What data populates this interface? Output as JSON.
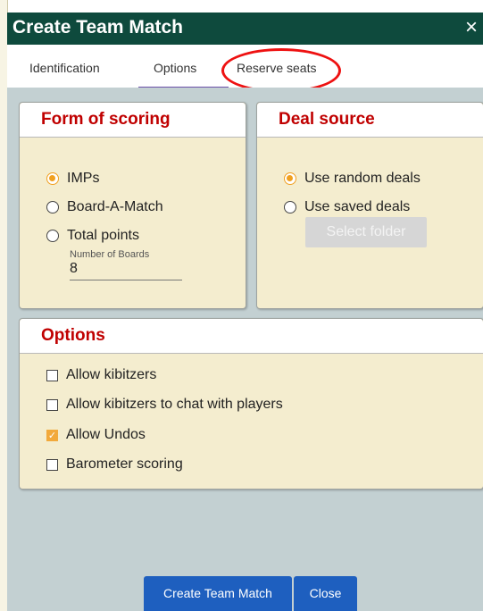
{
  "dialog": {
    "title": "Create Team Match",
    "close_glyph": "×"
  },
  "tabs": [
    {
      "label": "Identification"
    },
    {
      "label": "Options",
      "active": true
    },
    {
      "label": "Reserve seats",
      "highlighted": true
    }
  ],
  "scoring": {
    "heading": "Form of scoring",
    "options": [
      {
        "label": "IMPs",
        "selected": true
      },
      {
        "label": "Board-A-Match",
        "selected": false
      },
      {
        "label": "Total points",
        "selected": false
      }
    ],
    "boards_label": "Number of Boards",
    "boards_value": "8"
  },
  "deal_source": {
    "heading": "Deal source",
    "options": [
      {
        "label": "Use random deals",
        "selected": true
      },
      {
        "label": "Use saved deals",
        "selected": false
      }
    ],
    "select_folder_label": "Select folder"
  },
  "options": {
    "heading": "Options",
    "checks": [
      {
        "label": "Allow kibitzers",
        "checked": false
      },
      {
        "label": "Allow kibitzers to chat with players",
        "checked": false
      },
      {
        "label": "Allow Undos",
        "checked": true
      },
      {
        "label": "Barometer scoring",
        "checked": false
      }
    ]
  },
  "footer": {
    "create_label": "Create Team Match",
    "close_label": "Close"
  },
  "colors": {
    "titlebar": "#0e4a3d",
    "accent": "#c00000",
    "selected": "#f0a020",
    "primary_button": "#1e5fbf",
    "annotation_circle": "#e11111"
  }
}
